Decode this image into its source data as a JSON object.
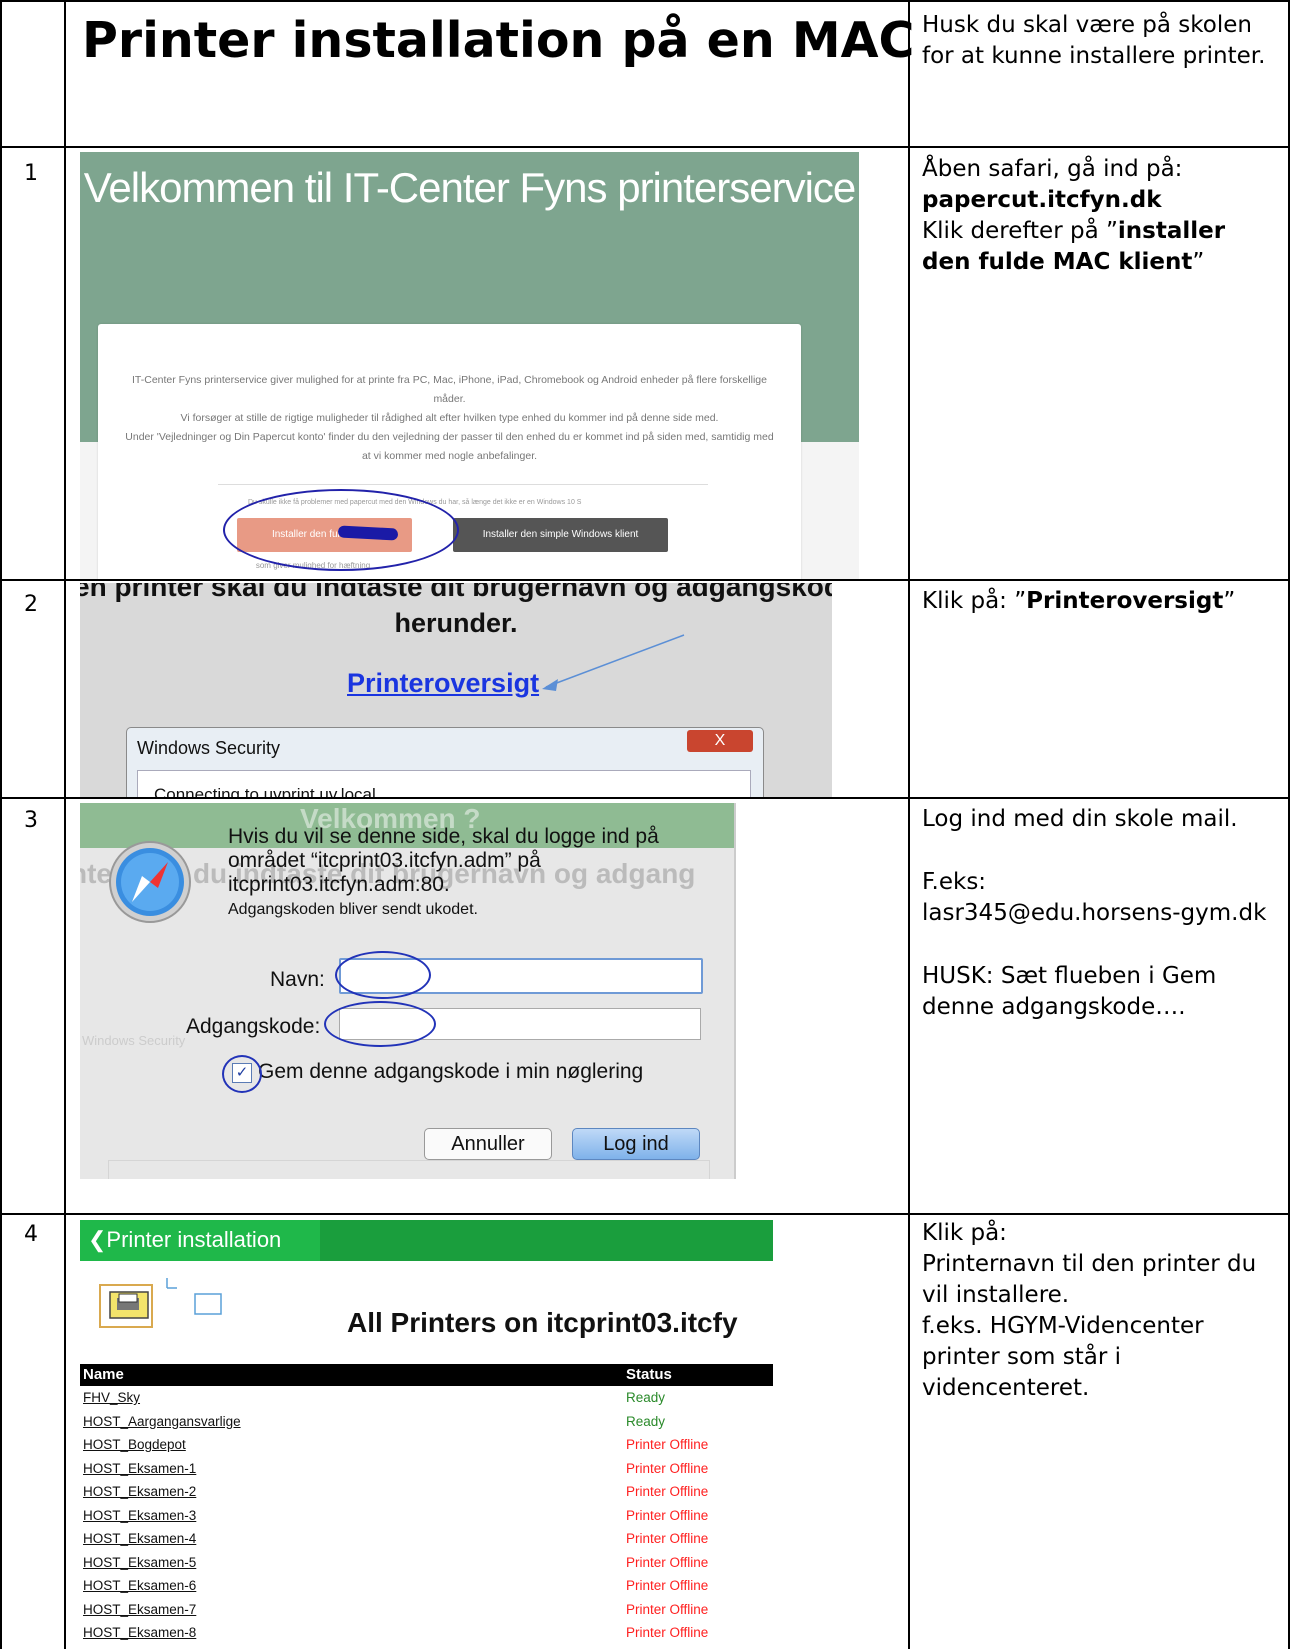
{
  "title": "Printer installation på en MAC",
  "header_note": "Husk du skal være på skolen for at kunne installere printer.",
  "steps": [
    {
      "number": "1",
      "note_a": "Åben safari, gå ind på:",
      "note_b": "papercut.itcfyn.dk",
      "note_c": "Klik derefter på ”",
      "note_d": "installer den fulde MAC klient",
      "note_e": "”",
      "screenshot": {
        "welcome": "Velkommen til IT-Center Fyns printerservice",
        "intro_1": "IT-Center Fyns printerservice giver mulighed for at printe fra PC, Mac, iPhone, iPad, Chromebook og Android enheder på flere forskellige måder.",
        "intro_2": "Vi forsøger at stille de rigtige muligheder til rådighed alt efter hvilken type enhed du kommer ind på denne side med.",
        "intro_3": "Under 'Vejledninger og Din Papercut konto' finder du den vejledning der passer til den enhed du er kommet ind på siden med, samtidig med at vi kommer med nogle anbefalinger.",
        "small_note": "Du skulle ikke få problemer med papercut med den Windows du har, så længe det ikke er en Windows 10 S",
        "btn_full": "Installer den fulde              klient",
        "btn_simple": "Installer den simple Windows klient",
        "below_btn": "som giver mulighed for hæftning"
      }
    },
    {
      "number": "2",
      "note_a": "Klik på: ”",
      "note_b": "Printeroversigt",
      "note_c": "”",
      "screenshot": {
        "cut_line": "en printer skal du indtaste dit brugernavn og adgangskode",
        "herunder": "herunder.",
        "link": "Printeroversigt",
        "dialog_title": "Windows Security",
        "dialog_close": "X",
        "dialog_text": "Connecting to uvprint.uv.local."
      }
    },
    {
      "number": "3",
      "note_a": "Log ind med din skole mail.",
      "note_b": "F.eks:",
      "note_c": "lasr345@edu.horsens-gym.dk",
      "note_d": "HUSK: Sæt flueben i Gem denne adgangskode….",
      "screenshot": {
        "bg_1": "Velkommen ?",
        "bg_2": "nter skal du indtaste dit brugernavn og adgang",
        "bg_3": "Windows Security",
        "message": "Hvis du vil se denne side, skal du logge ind på området “itcprint03.itcfyn.adm” på itcprint03.itcfyn.adm:80.",
        "submessage": "Adgangskoden bliver sendt ukodet.",
        "name_label": "Navn:",
        "password_label": "Adgangskode:",
        "remember_label": "Gem denne adgangskode i min nøglering",
        "checkbox_mark": "✓",
        "cancel": "Annuller",
        "login": "Log ind"
      }
    },
    {
      "number": "4",
      "note_a": "Klik på:",
      "note_b": "Printernavn til den printer du vil installere.",
      "note_c": "f.eks. HGYM-Videncenter printer som står i videncenteret.",
      "screenshot": {
        "back": "❮Printer installation",
        "heading": "All Printers on itcprint03.itcfy",
        "col_name": "Name",
        "col_status": "Status",
        "printers": [
          {
            "name": "FHV_Sky",
            "status": "Ready",
            "color": "#2a8a2a"
          },
          {
            "name": "HOST_Aargangansvarlige",
            "status": "Ready",
            "color": "#2a8a2a"
          },
          {
            "name": "HOST_Bogdepot",
            "status": "Printer Offline",
            "color": "#ff2020"
          },
          {
            "name": "HOST_Eksamen-1",
            "status": "Printer Offline",
            "color": "#ff2020"
          },
          {
            "name": "HOST_Eksamen-2",
            "status": "Printer Offline",
            "color": "#ff2020"
          },
          {
            "name": "HOST_Eksamen-3",
            "status": "Printer Offline",
            "color": "#ff2020"
          },
          {
            "name": "HOST_Eksamen-4",
            "status": "Printer Offline",
            "color": "#ff2020"
          },
          {
            "name": "HOST_Eksamen-5",
            "status": "Printer Offline",
            "color": "#ff2020"
          },
          {
            "name": "HOST_Eksamen-6",
            "status": "Printer Offline",
            "color": "#ff2020"
          },
          {
            "name": "HOST_Eksamen-7",
            "status": "Printer Offline",
            "color": "#ff2020"
          },
          {
            "name": "HOST_Eksamen-8",
            "status": "Printer Offline",
            "color": "#ff2020"
          }
        ]
      }
    }
  ]
}
